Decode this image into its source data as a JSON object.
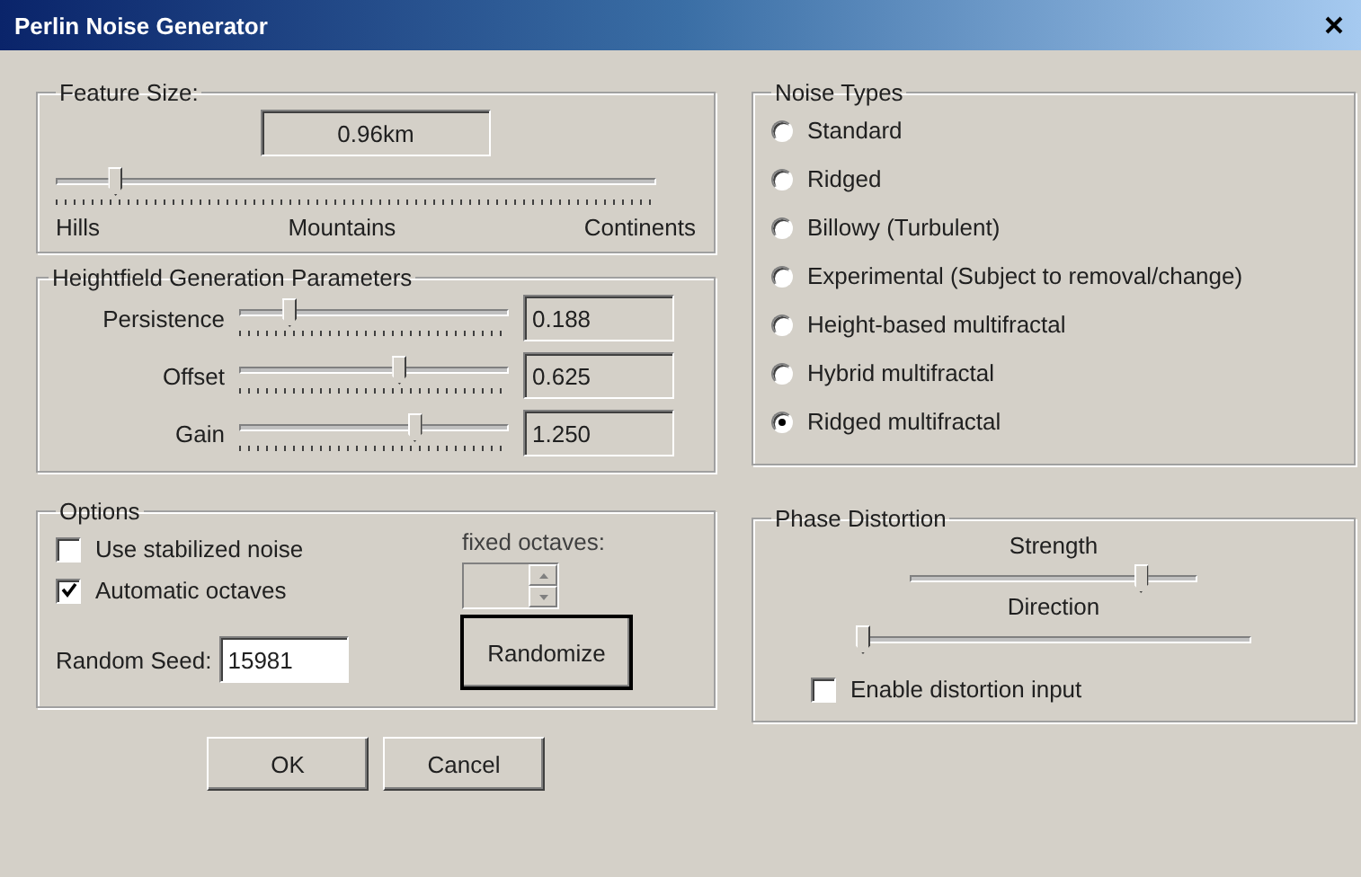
{
  "window": {
    "title": "Perlin Noise Generator"
  },
  "feature_size": {
    "title": "Feature Size:",
    "value": "0.96km",
    "level": 0.09,
    "labels": [
      "Hills",
      "Mountains",
      "Continents"
    ]
  },
  "heightfield": {
    "title": "Heightfield Generation Parameters",
    "params": [
      {
        "label": "Persistence",
        "level": 0.17,
        "value": "0.188"
      },
      {
        "label": "Offset",
        "level": 0.6,
        "value": "0.625"
      },
      {
        "label": "Gain",
        "level": 0.66,
        "value": "1.250"
      }
    ]
  },
  "noise_types": {
    "title": "Noise Types",
    "options": [
      {
        "label": "Standard",
        "selected": false
      },
      {
        "label": "Ridged",
        "selected": false
      },
      {
        "label": "Billowy (Turbulent)",
        "selected": false
      },
      {
        "label": "Experimental (Subject to removal/change)",
        "selected": false
      },
      {
        "label": "Height-based multifractal",
        "selected": false
      },
      {
        "label": "Hybrid multifractal",
        "selected": false
      },
      {
        "label": "Ridged multifractal",
        "selected": true
      }
    ]
  },
  "options": {
    "title": "Options",
    "checkboxes": [
      {
        "label": "Use stabilized noise",
        "checked": false
      },
      {
        "label": "Automatic octaves",
        "checked": true
      }
    ],
    "fixed_octaves": {
      "label": "fixed octaves:",
      "disabled": true
    },
    "seed": {
      "label": "Random Seed:",
      "value": "15981"
    },
    "randomize": "Randomize"
  },
  "phase_distortion": {
    "title": "Phase Distortion",
    "sliders": [
      {
        "label": "Strength",
        "level": 0.82
      },
      {
        "label": "Direction",
        "level": 0.0
      }
    ],
    "checkbox": {
      "label": "Enable distortion input",
      "checked": false
    }
  },
  "buttons": [
    "OK",
    "Cancel"
  ]
}
